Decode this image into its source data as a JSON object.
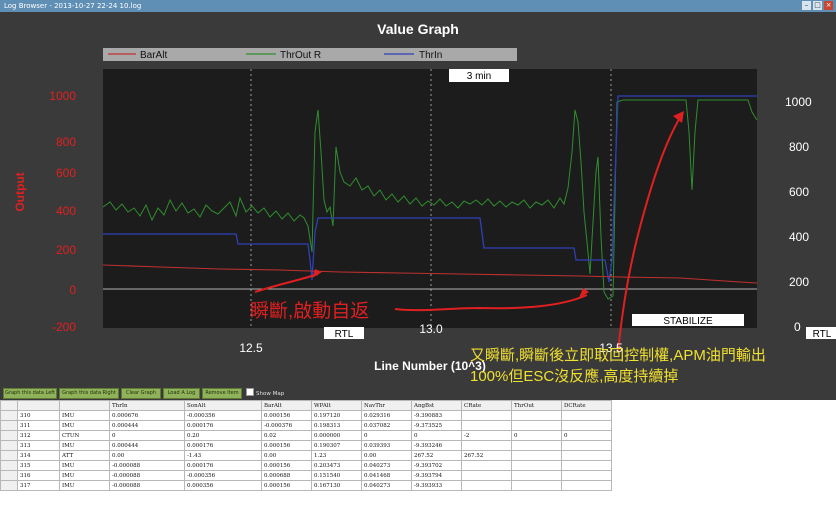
{
  "window": {
    "title": "Log Browser - 2013-10-27 22-24 10.log"
  },
  "graph": {
    "title": "Value Graph",
    "legend": [
      {
        "name": "BarAlt",
        "color": "#c03030"
      },
      {
        "name": "ThrOut R",
        "color": "#2f8f2f"
      },
      {
        "name": "ThrIn",
        "color": "#2f3fb8"
      }
    ],
    "zoom_label": "3 min",
    "x_axis": {
      "title": "Line Number (10^3)",
      "ticks": [
        "12.5",
        "13.0",
        "13.5"
      ]
    },
    "left_axis": {
      "title": "Output",
      "ticks": [
        "1000",
        "800",
        "600",
        "400",
        "200",
        "0",
        "-200"
      ]
    },
    "right_axis": {
      "ticks": [
        "1000",
        "800",
        "600",
        "400",
        "200",
        "0"
      ]
    },
    "mode_labels": [
      "RTL",
      "STABILIZE",
      "RTL"
    ],
    "annotations": [
      "瞬斷,啟動自返",
      "又瞬斷,瞬斷後立即取回控制權,APM油門輸出",
      "100%但ESC沒反應,高度持續掉"
    ]
  },
  "buttons": [
    "Graph this data Left",
    "Graph this data Right",
    "Clear Graph",
    "Load A Log",
    "Remove Item"
  ],
  "show_map": "Show Map",
  "table": {
    "headers": [
      "",
      "",
      "ThrIn",
      "SonAlt",
      "BarAlt",
      "WPAlt",
      "NavThr",
      "AngBst",
      "CRate",
      "ThrOut",
      "DCRate"
    ],
    "rows": [
      [
        "310",
        "IMU",
        "0.000676",
        "-0.000356",
        "0.000156",
        "0.197120",
        "0.029316",
        "-9.390883",
        "",
        "",
        ""
      ],
      [
        "311",
        "IMU",
        "0.000444",
        "0.000176",
        "-0.000376",
        "0.198313",
        "0.037082",
        "-9.373525",
        "",
        "",
        ""
      ],
      [
        "312",
        "CTUN",
        "0",
        "0.20",
        "0.02",
        "0.000000",
        "0",
        "0",
        "-2",
        "0",
        "0"
      ],
      [
        "313",
        "IMU",
        "0.000444",
        "0.000176",
        "0.000156",
        "0.190307",
        "0.039393",
        "-9.393246",
        "",
        "",
        ""
      ],
      [
        "314",
        "ATT",
        "0.00",
        "-1.43",
        "0.00",
        "1.23",
        "0.00",
        "267.52",
        "267.52",
        "",
        ""
      ],
      [
        "315",
        "IMU",
        "-0.000088",
        "0.000176",
        "0.000156",
        "0.203473",
        "0.040273",
        "-9.393702",
        "",
        "",
        ""
      ],
      [
        "316",
        "IMU",
        "-0.000088",
        "-0.000356",
        "0.000688",
        "0.151540",
        "0.041468",
        "-9.393794",
        "",
        "",
        ""
      ],
      [
        "317",
        "IMU",
        "-0.000088",
        "0.000356",
        "0.000156",
        "0.167130",
        "0.040273",
        "-9.393933",
        "",
        "",
        ""
      ]
    ]
  }
}
